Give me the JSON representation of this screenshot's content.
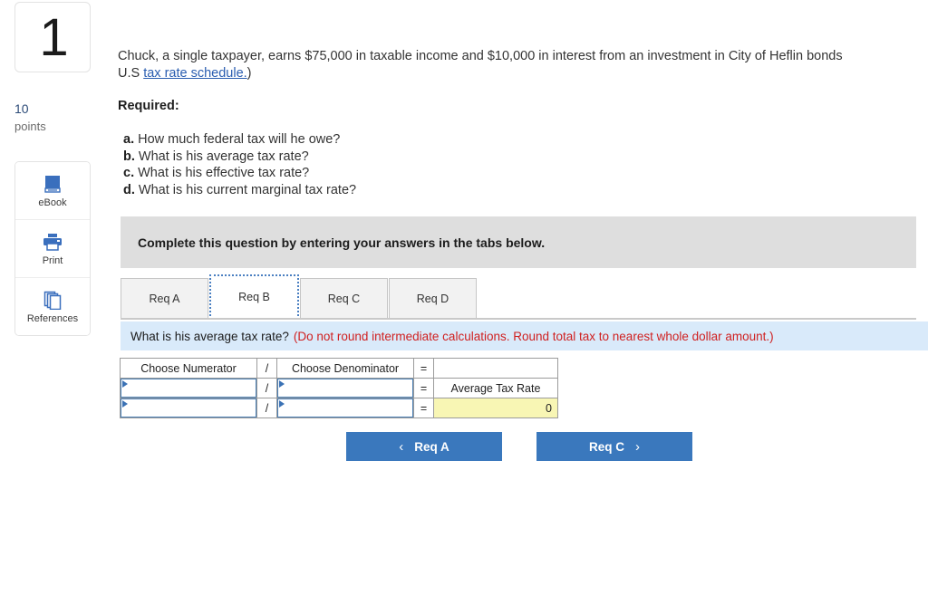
{
  "sidebar": {
    "question_number": "1",
    "points_value": "10",
    "points_label": "points",
    "tools": [
      {
        "icon": "ebook-icon",
        "label": "eBook"
      },
      {
        "icon": "printer-icon",
        "label": "Print"
      },
      {
        "icon": "references-copy-icon",
        "label": "References"
      }
    ]
  },
  "question": {
    "line1_a": "Chuck, a single taxpayer, earns $75,000 in taxable income and $10,000 in interest from an investment in City of Heflin bonds",
    "line2_prefix": "U.S ",
    "line2_link": "tax rate schedule.",
    "line2_suffix": ")",
    "required_heading": "Required:",
    "required_items": [
      {
        "marker": "a.",
        "text": "How much federal tax will he owe?"
      },
      {
        "marker": "b.",
        "text": "What is his average tax rate?"
      },
      {
        "marker": "c.",
        "text": "What is his effective tax rate?"
      },
      {
        "marker": "d.",
        "text": "What is his current marginal tax rate?"
      }
    ]
  },
  "instruction_bar": {
    "text": "Complete this question by entering your answers in the tabs below."
  },
  "tabs": {
    "items": [
      {
        "label": "Req A",
        "active": false
      },
      {
        "label": "Req B",
        "active": true
      },
      {
        "label": "Req C",
        "active": false
      },
      {
        "label": "Req D",
        "active": false
      }
    ]
  },
  "question_bar": {
    "prompt": "What is his average tax rate?",
    "note": "(Do not round intermediate calculations. Round total tax to nearest whole dollar amount.)"
  },
  "answer_table": {
    "headers": {
      "numerator": "Choose Numerator",
      "slash": "/",
      "denominator": "Choose Denominator",
      "equals": "=",
      "result": ""
    },
    "rows": [
      {
        "numerator_value": "",
        "slash": "/",
        "denominator_value": "",
        "equals": "=",
        "result_label": "Average Tax Rate"
      },
      {
        "numerator_value": "",
        "slash": "/",
        "denominator_value": "",
        "equals": "=",
        "result_value": "0"
      }
    ]
  },
  "navigation": {
    "prev_chevron": "‹",
    "prev_label": "Req A",
    "next_label": "Req C",
    "next_chevron": "›"
  },
  "colors": {
    "accent_blue": "#3a78bd",
    "link_blue": "#2a5db0",
    "note_red": "#d02020",
    "qbar_blue": "#d9eafa",
    "instruction_gray": "#dedede",
    "answer_yellow": "#f8f6b4",
    "input_border_blue": "#4a7fb5"
  }
}
